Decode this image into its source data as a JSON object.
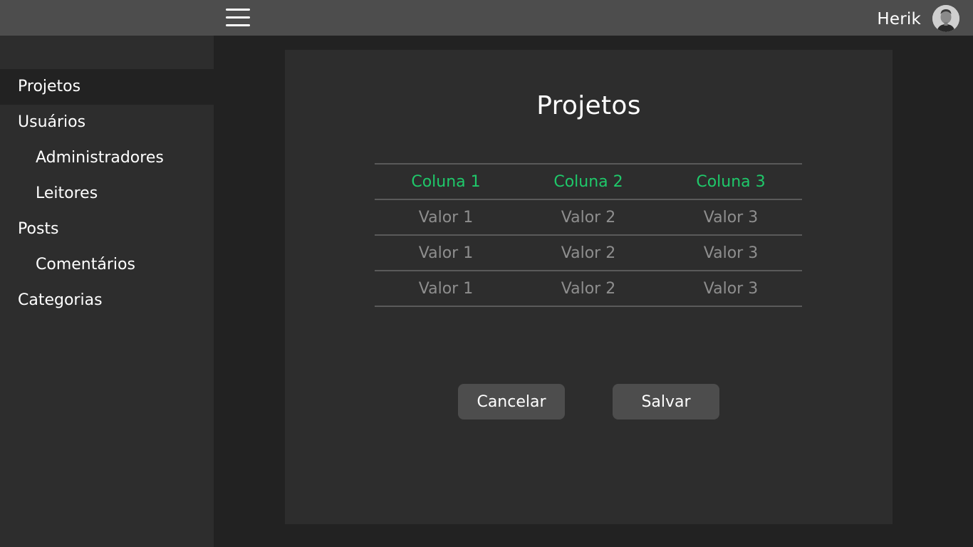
{
  "header": {
    "user_name": "Herik"
  },
  "sidebar": {
    "items": [
      {
        "label": "Projetos",
        "level": 1,
        "active": true
      },
      {
        "label": "Usuários",
        "level": 1,
        "active": false
      },
      {
        "label": "Administradores",
        "level": 2,
        "active": false
      },
      {
        "label": "Leitores",
        "level": 2,
        "active": false
      },
      {
        "label": "Posts",
        "level": 1,
        "active": false
      },
      {
        "label": "Comentários",
        "level": 2,
        "active": false
      },
      {
        "label": "Categorias",
        "level": 1,
        "active": false
      }
    ]
  },
  "main": {
    "title": "Projetos",
    "table": {
      "columns": [
        "Coluna 1",
        "Coluna 2",
        "Coluna 3"
      ],
      "rows": [
        [
          "Valor 1",
          "Valor 2",
          "Valor 3"
        ],
        [
          "Valor 1",
          "Valor 2",
          "Valor 3"
        ],
        [
          "Valor 1",
          "Valor 2",
          "Valor 3"
        ]
      ]
    },
    "buttons": {
      "cancel_label": "Cancelar",
      "save_label": "Salvar"
    }
  },
  "colors": {
    "header_bg": "#4d4d4d",
    "sidebar_bg": "#2d2d2d",
    "page_bg": "#222222",
    "accent": "#1fc86a",
    "cell_text": "#8e8e8e"
  },
  "icons": {
    "menu": "hamburger-menu-icon",
    "avatar": "user-avatar"
  }
}
